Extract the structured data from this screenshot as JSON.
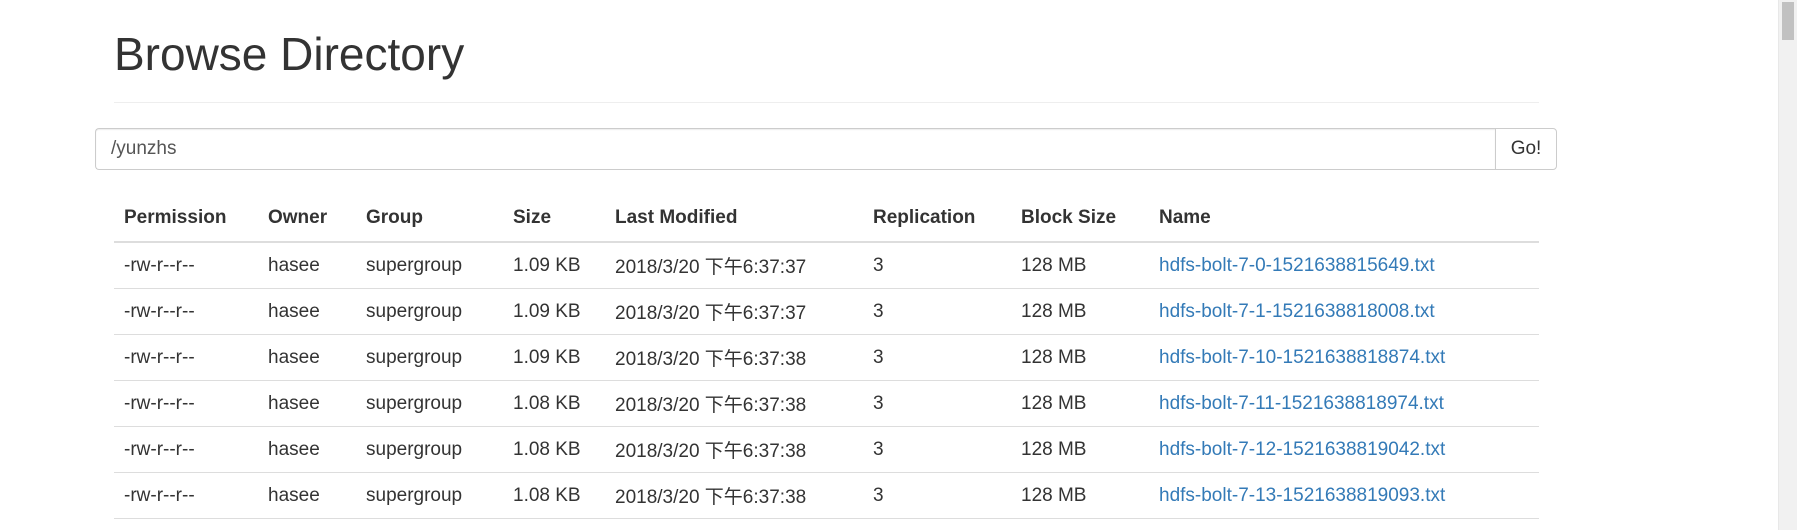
{
  "page": {
    "title": "Browse Directory"
  },
  "path_bar": {
    "value": "/yunzhs",
    "go_label": "Go!"
  },
  "table": {
    "columns": [
      "Permission",
      "Owner",
      "Group",
      "Size",
      "Last Modified",
      "Replication",
      "Block Size",
      "Name"
    ],
    "rows": [
      {
        "permission": "-rw-r--r--",
        "owner": "hasee",
        "group": "supergroup",
        "size": "1.09 KB",
        "modified": "2018/3/20 下午6:37:37",
        "replication": "3",
        "block_size": "128 MB",
        "name": "hdfs-bolt-7-0-1521638815649.txt"
      },
      {
        "permission": "-rw-r--r--",
        "owner": "hasee",
        "group": "supergroup",
        "size": "1.09 KB",
        "modified": "2018/3/20 下午6:37:37",
        "replication": "3",
        "block_size": "128 MB",
        "name": "hdfs-bolt-7-1-1521638818008.txt"
      },
      {
        "permission": "-rw-r--r--",
        "owner": "hasee",
        "group": "supergroup",
        "size": "1.09 KB",
        "modified": "2018/3/20 下午6:37:38",
        "replication": "3",
        "block_size": "128 MB",
        "name": "hdfs-bolt-7-10-1521638818874.txt"
      },
      {
        "permission": "-rw-r--r--",
        "owner": "hasee",
        "group": "supergroup",
        "size": "1.08 KB",
        "modified": "2018/3/20 下午6:37:38",
        "replication": "3",
        "block_size": "128 MB",
        "name": "hdfs-bolt-7-11-1521638818974.txt"
      },
      {
        "permission": "-rw-r--r--",
        "owner": "hasee",
        "group": "supergroup",
        "size": "1.08 KB",
        "modified": "2018/3/20 下午6:37:38",
        "replication": "3",
        "block_size": "128 MB",
        "name": "hdfs-bolt-7-12-1521638819042.txt"
      },
      {
        "permission": "-rw-r--r--",
        "owner": "hasee",
        "group": "supergroup",
        "size": "1.08 KB",
        "modified": "2018/3/20 下午6:37:38",
        "replication": "3",
        "block_size": "128 MB",
        "name": "hdfs-bolt-7-13-1521638819093.txt"
      }
    ]
  },
  "colors": {
    "link": "#337ab7",
    "text": "#333333",
    "border": "#dddddd"
  }
}
